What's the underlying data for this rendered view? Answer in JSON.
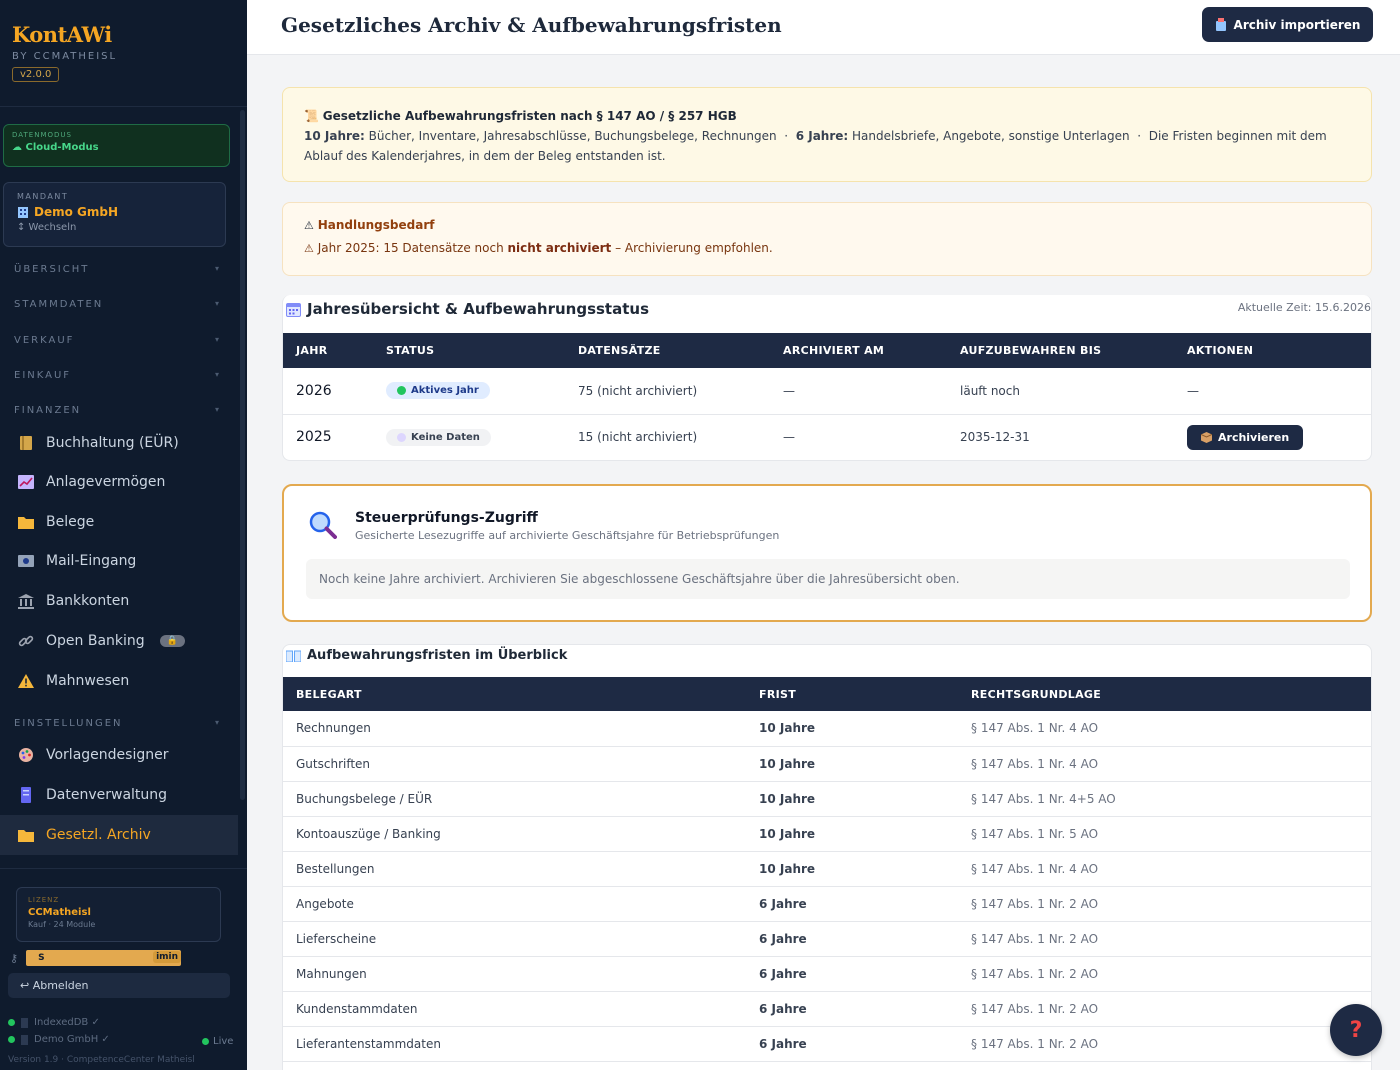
{
  "brand": {
    "title": "KontAWi",
    "subtitle": "BY CCMATHEISL",
    "version": "v2.0.0"
  },
  "mode": {
    "label": "DATENMODUS",
    "value": "☁ Cloud-Modus"
  },
  "client": {
    "label": "MANDANT",
    "name": "Demo GmbH",
    "switch": "↕ Wechseln"
  },
  "nav": {
    "sections": [
      "ÜBERSICHT",
      "STAMMDATEN",
      "VERKAUF",
      "EINKAUF",
      "FINANZEN",
      "EINSTELLUNGEN"
    ],
    "finance_items": [
      {
        "label": "Buchhaltung (EÜR)",
        "icon": "ledger-icon"
      },
      {
        "label": "Anlagevermögen",
        "icon": "chart-icon"
      },
      {
        "label": "Belege",
        "icon": "folder-icon"
      },
      {
        "label": "Mail-Eingang",
        "icon": "mail-icon"
      },
      {
        "label": "Bankkonten",
        "icon": "bank-icon"
      },
      {
        "label": "Open Banking",
        "icon": "link-icon",
        "badge": "🔒"
      },
      {
        "label": "Mahnwesen",
        "icon": "warning-icon"
      }
    ],
    "settings_items": [
      {
        "label": "Vorlagendesigner",
        "icon": "palette-icon"
      },
      {
        "label": "Datenverwaltung",
        "icon": "database-icon"
      },
      {
        "label": "Gesetzl. Archiv",
        "icon": "folder-icon"
      }
    ]
  },
  "license": {
    "label": "LIZENZ",
    "name": "CCMatheisl",
    "sub": "Kauf · 24 Module"
  },
  "user": {
    "initial": "S",
    "role": "imin"
  },
  "logout": "↩ Abmelden",
  "status": {
    "db": "IndexedDB ✓",
    "client": "Demo GmbH ✓",
    "live": "Live"
  },
  "footer_version": "Version 1.9 · CompetenceCenter Matheisl",
  "header": {
    "title": "Gesetzliches Archiv & Aufbewahrungsfristen",
    "import_label": "Archiv importieren"
  },
  "info": {
    "title": "Gesetzliche Aufbewahrungsfristen nach § 147 AO / § 257 HGB",
    "ten_label": "10 Jahre:",
    "ten_text": "Bücher, Inventare, Jahresabschlüsse, Buchungsbelege, Rechnungen",
    "six_label": "6 Jahre:",
    "six_text": "Handelsbriefe, Angebote, sonstige Unterlagen",
    "start_text": "Die Fristen beginnen mit dem Ablauf des Kalenderjahres, in dem der Beleg entstanden ist."
  },
  "action": {
    "title": "Handlungsbedarf",
    "prefix": "Jahr 2025: 15 Datensätze noch",
    "bold": "nicht archiviert",
    "suffix": "– Archivierung empfohlen."
  },
  "years": {
    "title": "Jahresübersicht & Aufbewahrungsstatus",
    "time": "Aktuelle Zeit: 15.6.2026",
    "headers": [
      "JAHR",
      "STATUS",
      "DATENSÄTZE",
      "ARCHIVIERT AM",
      "AUFZUBEWAHREN BIS",
      "AKTIONEN"
    ],
    "rows": [
      {
        "year": "2026",
        "status": "Aktives Jahr",
        "records": "75 (nicht archiviert)",
        "archived": "—",
        "keep_until": "läuft noch",
        "action": "—"
      },
      {
        "year": "2025",
        "status": "Keine Daten",
        "records": "15 (nicht archiviert)",
        "archived": "—",
        "keep_until": "2035-12-31",
        "action": "Archivieren"
      }
    ]
  },
  "audit": {
    "title": "Steuerprüfungs-Zugriff",
    "subtitle": "Gesicherte Lesezugriffe auf archivierte Geschäftsjahre für Betriebsprüfungen",
    "note": "Noch keine Jahre archiviert. Archivieren Sie abgeschlossene Geschäftsjahre über die Jahresübersicht oben."
  },
  "retention": {
    "title": "Aufbewahrungsfristen im Überblick",
    "headers": [
      "BELEGART",
      "FRIST",
      "RECHTSGRUNDLAGE"
    ],
    "rows": [
      {
        "type": "Rechnungen",
        "period": "10 Jahre",
        "law": "§ 147 Abs. 1 Nr. 4 AO"
      },
      {
        "type": "Gutschriften",
        "period": "10 Jahre",
        "law": "§ 147 Abs. 1 Nr. 4 AO"
      },
      {
        "type": "Buchungsbelege / EÜR",
        "period": "10 Jahre",
        "law": "§ 147 Abs. 1 Nr. 4+5 AO"
      },
      {
        "type": "Kontoauszüge / Banking",
        "period": "10 Jahre",
        "law": "§ 147 Abs. 1 Nr. 5 AO"
      },
      {
        "type": "Bestellungen",
        "period": "10 Jahre",
        "law": "§ 147 Abs. 1 Nr. 4 AO"
      },
      {
        "type": "Angebote",
        "period": "6 Jahre",
        "law": "§ 147 Abs. 1 Nr. 2 AO"
      },
      {
        "type": "Lieferscheine",
        "period": "6 Jahre",
        "law": "§ 147 Abs. 1 Nr. 2 AO"
      },
      {
        "type": "Mahnungen",
        "period": "6 Jahre",
        "law": "§ 147 Abs. 1 Nr. 2 AO"
      },
      {
        "type": "Kundenstammdaten",
        "period": "6 Jahre",
        "law": "§ 147 Abs. 1 Nr. 2 AO"
      },
      {
        "type": "Lieferantenstammdaten",
        "period": "6 Jahre",
        "law": "§ 147 Abs. 1 Nr. 2 AO"
      }
    ]
  },
  "help": "?",
  "colors": {
    "accent": "#f5a623",
    "navy": "#1e2a44",
    "sidebar": "#0f1b2d",
    "ten_years": "#b91c1c",
    "six_years": "#15803d"
  }
}
